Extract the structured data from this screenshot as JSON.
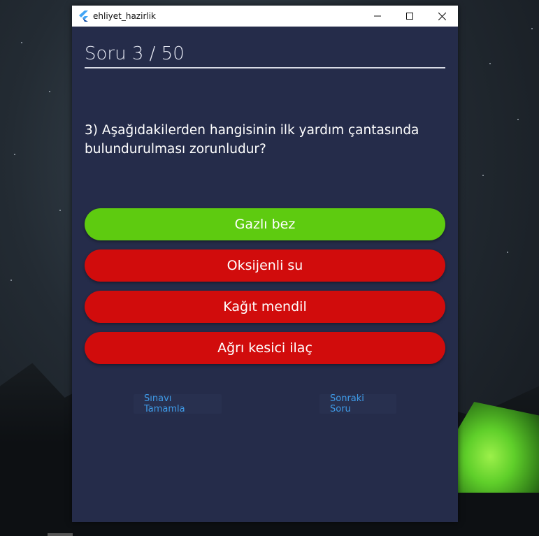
{
  "window": {
    "title": "ehliyet_hazirlik"
  },
  "quiz": {
    "counter": "Soru 3 / 50",
    "question": "3) Aşağıdakilerden hangisinin ilk yardım çantasında bulundurulması zorunludur?",
    "answers": [
      {
        "label": "Gazlı bez",
        "state": "correct"
      },
      {
        "label": "Oksijenli su",
        "state": "wrong"
      },
      {
        "label": "Kağıt mendil",
        "state": "wrong"
      },
      {
        "label": "Ağrı kesici ilaç",
        "state": "wrong"
      }
    ],
    "finish_label": "Sınavı Tamamla",
    "next_label": "Sonraki Soru"
  },
  "colors": {
    "background": "#252c4a",
    "correct": "#5ecb10",
    "wrong": "#d10c0c",
    "link": "#3f9be8"
  },
  "icons": {
    "app": "flutter-logo-icon",
    "minimize": "minimize-icon",
    "maximize": "maximize-icon",
    "close": "close-icon"
  }
}
